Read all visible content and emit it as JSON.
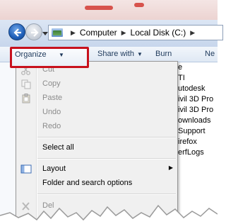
{
  "address_bar": {
    "breadcrumbs": [
      "Computer",
      "Local Disk (C:)"
    ]
  },
  "toolbar": {
    "organize_label": "Organize",
    "share_with_label": "Share with",
    "burn_label": "Burn",
    "new_folder_label_partial": "Ne"
  },
  "organize_menu": {
    "items": [
      {
        "label": "Cut",
        "enabled": false,
        "icon": "scissors-icon"
      },
      {
        "label": "Copy",
        "enabled": false,
        "icon": "copy-icon"
      },
      {
        "label": "Paste",
        "enabled": false,
        "icon": "clipboard-icon"
      },
      {
        "label": "Undo",
        "enabled": false
      },
      {
        "label": "Redo",
        "enabled": false
      },
      {
        "label": "Select all",
        "enabled": true
      },
      {
        "label": "Layout",
        "enabled": true,
        "icon": "layout-icon",
        "submenu": true
      },
      {
        "label": "Folder and search options",
        "enabled": true
      },
      {
        "label": "Del",
        "enabled": false,
        "icon": "delete-icon"
      }
    ]
  },
  "file_list": {
    "items": [
      "e",
      "TI",
      "utodesk",
      "ivil 3D Pro",
      "ivil 3D Pro",
      "ownloads",
      "Support",
      "irefox",
      "erfLogs"
    ]
  },
  "colors": {
    "highlight_border": "#c8111d",
    "toolbar_text": "#1e395b"
  }
}
